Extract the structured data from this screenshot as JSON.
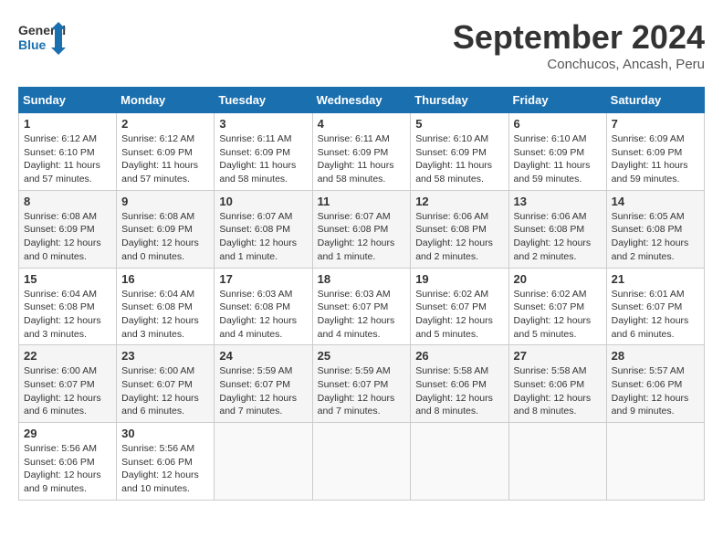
{
  "header": {
    "logo": {
      "line1": "General",
      "line2": "Blue"
    },
    "title": "September 2024",
    "subtitle": "Conchucos, Ancash, Peru"
  },
  "weekdays": [
    "Sunday",
    "Monday",
    "Tuesday",
    "Wednesday",
    "Thursday",
    "Friday",
    "Saturday"
  ],
  "weeks": [
    [
      {
        "day": 1,
        "sunrise": "6:12 AM",
        "sunset": "6:10 PM",
        "daylight": "11 hours and 57 minutes."
      },
      {
        "day": 2,
        "sunrise": "6:12 AM",
        "sunset": "6:09 PM",
        "daylight": "11 hours and 57 minutes."
      },
      {
        "day": 3,
        "sunrise": "6:11 AM",
        "sunset": "6:09 PM",
        "daylight": "11 hours and 58 minutes."
      },
      {
        "day": 4,
        "sunrise": "6:11 AM",
        "sunset": "6:09 PM",
        "daylight": "11 hours and 58 minutes."
      },
      {
        "day": 5,
        "sunrise": "6:10 AM",
        "sunset": "6:09 PM",
        "daylight": "11 hours and 58 minutes."
      },
      {
        "day": 6,
        "sunrise": "6:10 AM",
        "sunset": "6:09 PM",
        "daylight": "11 hours and 59 minutes."
      },
      {
        "day": 7,
        "sunrise": "6:09 AM",
        "sunset": "6:09 PM",
        "daylight": "11 hours and 59 minutes."
      }
    ],
    [
      {
        "day": 8,
        "sunrise": "6:08 AM",
        "sunset": "6:09 PM",
        "daylight": "12 hours and 0 minutes."
      },
      {
        "day": 9,
        "sunrise": "6:08 AM",
        "sunset": "6:09 PM",
        "daylight": "12 hours and 0 minutes."
      },
      {
        "day": 10,
        "sunrise": "6:07 AM",
        "sunset": "6:08 PM",
        "daylight": "12 hours and 1 minute."
      },
      {
        "day": 11,
        "sunrise": "6:07 AM",
        "sunset": "6:08 PM",
        "daylight": "12 hours and 1 minute."
      },
      {
        "day": 12,
        "sunrise": "6:06 AM",
        "sunset": "6:08 PM",
        "daylight": "12 hours and 2 minutes."
      },
      {
        "day": 13,
        "sunrise": "6:06 AM",
        "sunset": "6:08 PM",
        "daylight": "12 hours and 2 minutes."
      },
      {
        "day": 14,
        "sunrise": "6:05 AM",
        "sunset": "6:08 PM",
        "daylight": "12 hours and 2 minutes."
      }
    ],
    [
      {
        "day": 15,
        "sunrise": "6:04 AM",
        "sunset": "6:08 PM",
        "daylight": "12 hours and 3 minutes."
      },
      {
        "day": 16,
        "sunrise": "6:04 AM",
        "sunset": "6:08 PM",
        "daylight": "12 hours and 3 minutes."
      },
      {
        "day": 17,
        "sunrise": "6:03 AM",
        "sunset": "6:08 PM",
        "daylight": "12 hours and 4 minutes."
      },
      {
        "day": 18,
        "sunrise": "6:03 AM",
        "sunset": "6:07 PM",
        "daylight": "12 hours and 4 minutes."
      },
      {
        "day": 19,
        "sunrise": "6:02 AM",
        "sunset": "6:07 PM",
        "daylight": "12 hours and 5 minutes."
      },
      {
        "day": 20,
        "sunrise": "6:02 AM",
        "sunset": "6:07 PM",
        "daylight": "12 hours and 5 minutes."
      },
      {
        "day": 21,
        "sunrise": "6:01 AM",
        "sunset": "6:07 PM",
        "daylight": "12 hours and 6 minutes."
      }
    ],
    [
      {
        "day": 22,
        "sunrise": "6:00 AM",
        "sunset": "6:07 PM",
        "daylight": "12 hours and 6 minutes."
      },
      {
        "day": 23,
        "sunrise": "6:00 AM",
        "sunset": "6:07 PM",
        "daylight": "12 hours and 6 minutes."
      },
      {
        "day": 24,
        "sunrise": "5:59 AM",
        "sunset": "6:07 PM",
        "daylight": "12 hours and 7 minutes."
      },
      {
        "day": 25,
        "sunrise": "5:59 AM",
        "sunset": "6:07 PM",
        "daylight": "12 hours and 7 minutes."
      },
      {
        "day": 26,
        "sunrise": "5:58 AM",
        "sunset": "6:06 PM",
        "daylight": "12 hours and 8 minutes."
      },
      {
        "day": 27,
        "sunrise": "5:58 AM",
        "sunset": "6:06 PM",
        "daylight": "12 hours and 8 minutes."
      },
      {
        "day": 28,
        "sunrise": "5:57 AM",
        "sunset": "6:06 PM",
        "daylight": "12 hours and 9 minutes."
      }
    ],
    [
      {
        "day": 29,
        "sunrise": "5:56 AM",
        "sunset": "6:06 PM",
        "daylight": "12 hours and 9 minutes."
      },
      {
        "day": 30,
        "sunrise": "5:56 AM",
        "sunset": "6:06 PM",
        "daylight": "12 hours and 10 minutes."
      },
      null,
      null,
      null,
      null,
      null
    ]
  ]
}
